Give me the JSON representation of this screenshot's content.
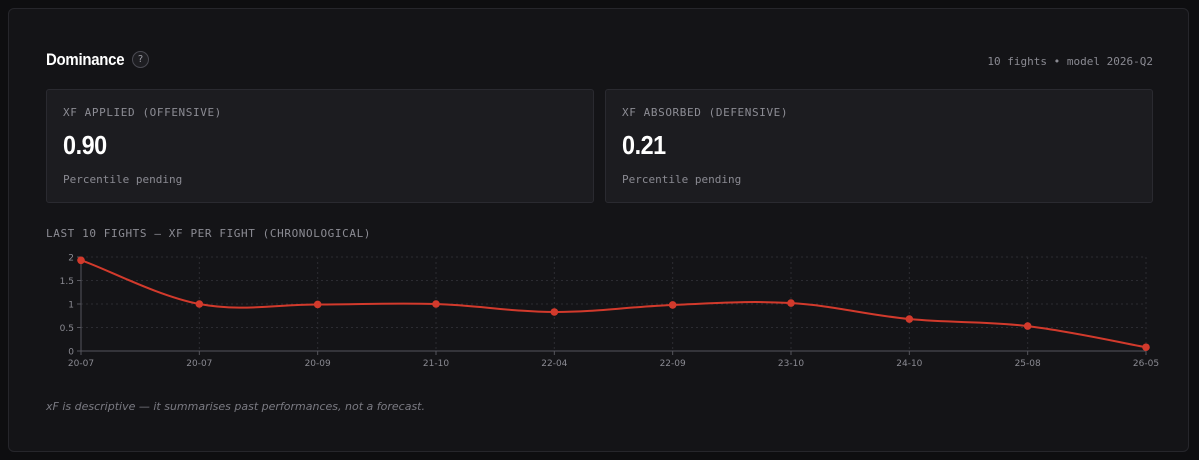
{
  "header": {
    "title": "Dominance",
    "help_icon": "?",
    "meta": "10 fights • model 2026-Q2"
  },
  "cards": [
    {
      "label": "XF APPLIED (OFFENSIVE)",
      "value": "0.90",
      "sub": "Percentile pending"
    },
    {
      "label": "XF ABSORBED (DEFENSIVE)",
      "value": "0.21",
      "sub": "Percentile pending"
    }
  ],
  "chart_section_label": "LAST 10 FIGHTS — XF PER FIGHT (CHRONOLOGICAL)",
  "chart_data": {
    "type": "line",
    "title": "",
    "xlabel": "",
    "ylabel": "",
    "categories": [
      "20-07",
      "20-07",
      "20-09",
      "21-10",
      "22-04",
      "22-09",
      "23-10",
      "24-10",
      "25-08",
      "26-05"
    ],
    "series": [
      {
        "values": [
          1.93,
          1.0,
          0.99,
          1.0,
          0.83,
          0.98,
          1.02,
          0.68,
          0.53,
          0.08
        ]
      }
    ],
    "ylim": [
      0,
      2
    ],
    "yticks": [
      0,
      0.5,
      1,
      1.5,
      2
    ],
    "ytick_labels": [
      "0",
      "0.5",
      "1",
      "1.5",
      "2"
    ],
    "grid": true,
    "line_color": "#d23a2c",
    "axis_color": "#55555c",
    "grid_color": "#2c2c32",
    "tick_color": "#8a8a92"
  },
  "footnote": "xF is descriptive — it summarises past performances, not a forecast."
}
